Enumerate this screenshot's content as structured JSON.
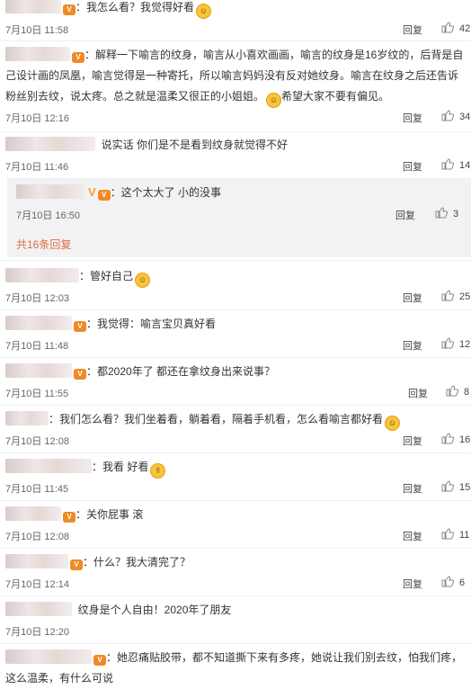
{
  "reply_label": "回复",
  "more_replies": "共16条回复",
  "comments": [
    {
      "id": "c1",
      "text": "：我怎么看？我觉得好看",
      "emoji": "😊",
      "time": "7月10日 11:58",
      "likes": "42"
    },
    {
      "id": "c2",
      "text": "：解释一下喻言的纹身，喻言从小喜欢画画，喻言的纹身是16岁纹的，后背是自己设计画的凤凰，喻言觉得是一种寄托，所以喻言妈妈没有反对她纹身。喻言在纹身之后还告诉粉丝别去纹，说太疼。总之就是温柔又很正的小姐姐。",
      "emoji": "😊",
      "text2": "希望大家不要有偏见。",
      "time": "7月10日 12:16",
      "likes": "34"
    },
    {
      "id": "c3",
      "text": "说实话 你们是不是看到纹身就觉得不好",
      "time": "7月10日 11:46",
      "likes": "14"
    },
    {
      "id": "r1",
      "text": "：这个太大了 小的没事",
      "time": "7月10日 16:50",
      "likes": "3"
    },
    {
      "id": "c4",
      "text": "：管好自己",
      "emoji": "😊",
      "time": "7月10日 12:03",
      "likes": "25"
    },
    {
      "id": "c5",
      "text": "：我觉得：喻言宝贝真好看",
      "time": "7月10日 11:48",
      "likes": "12"
    },
    {
      "id": "c6",
      "text": "：都2020年了 都还在拿纹身出来说事？",
      "time": "7月10日 11:55",
      "likes": "8"
    },
    {
      "id": "c7",
      "text": "：我们怎么看？我们坐着看，躺着看，隔着手机看，怎么看喻言都好看",
      "emoji": "😮",
      "time": "7月10日 12:08",
      "likes": "16"
    },
    {
      "id": "c8",
      "text": "：我看 好看",
      "emoji": "👌",
      "time": "7月10日 11:45",
      "likes": "15"
    },
    {
      "id": "c9",
      "text": "：关你屁事 滚",
      "time": "7月10日 12:08",
      "likes": "11"
    },
    {
      "id": "c10",
      "text": "：什么？我大清完了？",
      "time": "7月10日 12:14",
      "likes": "6"
    },
    {
      "id": "c11",
      "text": "纹身是个人自由！2020年了朋友",
      "time": "7月10日 12:20",
      "likes": ""
    },
    {
      "id": "c12",
      "text": "：她忍痛贴胶带，都不知道撕下来有多疼，她说让我们别去纹，怕我们疼，这么温柔，有什么可说",
      "time": "",
      "likes": ""
    }
  ]
}
